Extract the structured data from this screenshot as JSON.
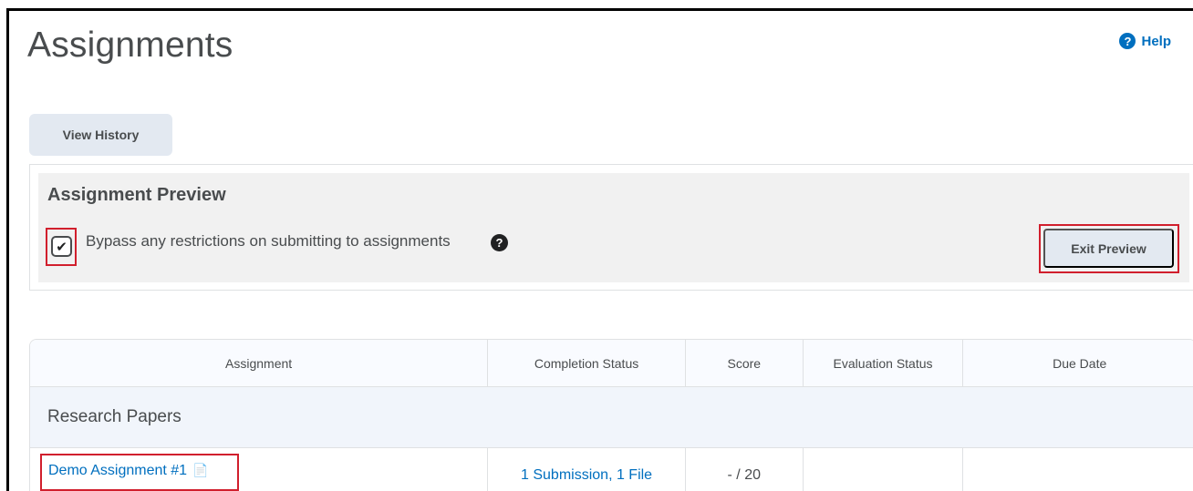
{
  "header": {
    "title": "Assignments",
    "help_label": "Help",
    "help_icon": "question-circle-icon"
  },
  "toolbar": {
    "view_history_label": "View History"
  },
  "preview": {
    "title": "Assignment Preview",
    "bypass_label": "Bypass any restrictions on submitting to assignments",
    "bypass_checked": true,
    "info_icon": "question-circle-icon",
    "exit_label": "Exit Preview"
  },
  "table": {
    "columns": [
      "Assignment",
      "Completion Status",
      "Score",
      "Evaluation Status",
      "Due Date"
    ],
    "groups": [
      {
        "name": "Research Papers",
        "rows": [
          {
            "assignment": "Demo Assignment #1",
            "assignment_icon": "preview-assignment-icon",
            "completion_status": "1 Submission, 1 File",
            "score": "- / 20",
            "evaluation_status": "",
            "due_date": ""
          }
        ]
      }
    ]
  },
  "colors": {
    "link": "#006fbf",
    "highlight": "#d11f2d",
    "button_bg": "#e3e9f1",
    "panel_bg": "#f1f1f1"
  }
}
